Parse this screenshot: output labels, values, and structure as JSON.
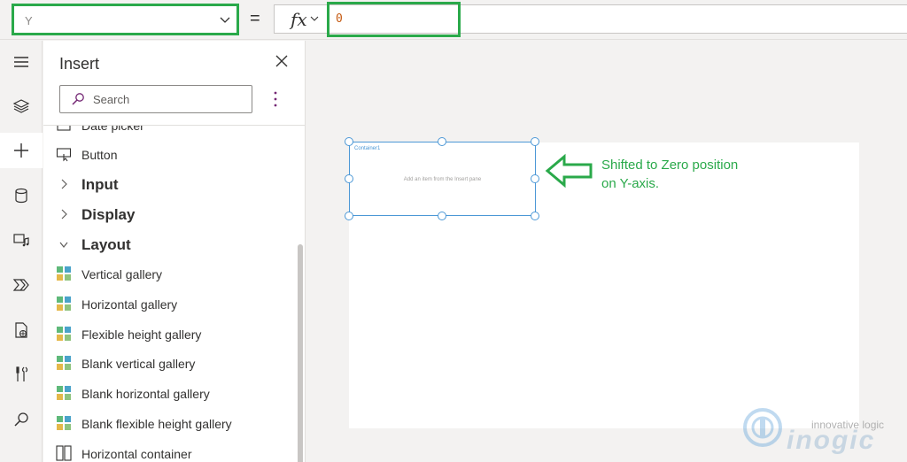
{
  "formula_bar": {
    "property_value": "Y",
    "equals": "=",
    "fx_label": "fx",
    "formula_value": "0"
  },
  "insert_pane": {
    "title": "Insert",
    "search_placeholder": "Search",
    "items": [
      {
        "label": "Date picker",
        "kind": "control"
      },
      {
        "label": "Button",
        "kind": "control"
      },
      {
        "label": "Input",
        "kind": "category"
      },
      {
        "label": "Display",
        "kind": "category"
      },
      {
        "label": "Layout",
        "kind": "category"
      },
      {
        "label": "Vertical gallery",
        "kind": "control"
      },
      {
        "label": "Horizontal gallery",
        "kind": "control"
      },
      {
        "label": "Flexible height gallery",
        "kind": "control"
      },
      {
        "label": "Blank vertical gallery",
        "kind": "control"
      },
      {
        "label": "Blank horizontal gallery",
        "kind": "control"
      },
      {
        "label": "Blank flexible height gallery",
        "kind": "control"
      },
      {
        "label": "Horizontal container",
        "kind": "control"
      }
    ]
  },
  "canvas": {
    "container_name": "Container1",
    "container_hint": "Add an item from the Insert pane"
  },
  "annotation": {
    "line1": "Shifted to Zero position",
    "line2": "on Y-axis."
  },
  "watermark": {
    "tagline": "innovative logic",
    "brand": "inogic"
  },
  "colors": {
    "highlight_green": "#2aa94a",
    "selection_blue": "#4c98d6",
    "accent_purple": "#742774",
    "formula_orange": "#c55a11"
  }
}
